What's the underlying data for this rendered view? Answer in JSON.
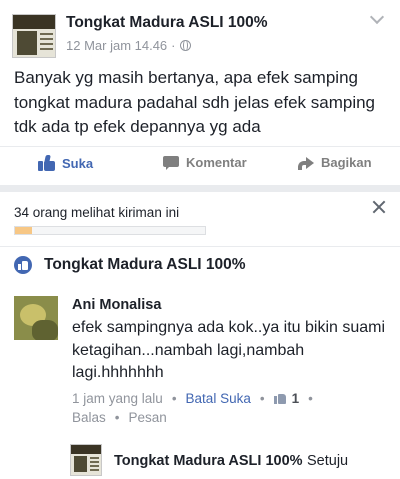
{
  "post": {
    "page_name": "Tongkat Madura ASLI 100%",
    "date": "12 Mar jam 14.46",
    "separator": "·",
    "icons": {
      "audience": "globe-icon",
      "menu": "chevron-down-icon"
    },
    "text": "Banyak yg masih bertanya, apa efek samping tongkat madura padahal sdh jelas efek samping tdk ada tp efek depannya yg ada"
  },
  "actions": {
    "like_label": "Suka",
    "comment_label": "Komentar",
    "share_label": "Bagikan",
    "accent_color": "#4267b2"
  },
  "views": {
    "text": "34 orang melihat kiriman ini",
    "progress_fraction": 0.09,
    "progress_color": "#f7c785"
  },
  "commenting_as": {
    "name": "Tongkat Madura ASLI 100%"
  },
  "comment": {
    "author": "Ani Monalisa",
    "text": "efek sampingnya ada kok..ya itu bikin suami ketagihan...nambah lagi,nambah lagi.hhhhhhh",
    "time": "1 jam yang lalu",
    "unlike_label": "Batal Suka",
    "like_count": "1",
    "reply_label": "Balas",
    "message_label": "Pesan",
    "separator": "•"
  },
  "reply": {
    "author": "Tongkat Madura ASLI 100%",
    "text": "Setuju"
  }
}
